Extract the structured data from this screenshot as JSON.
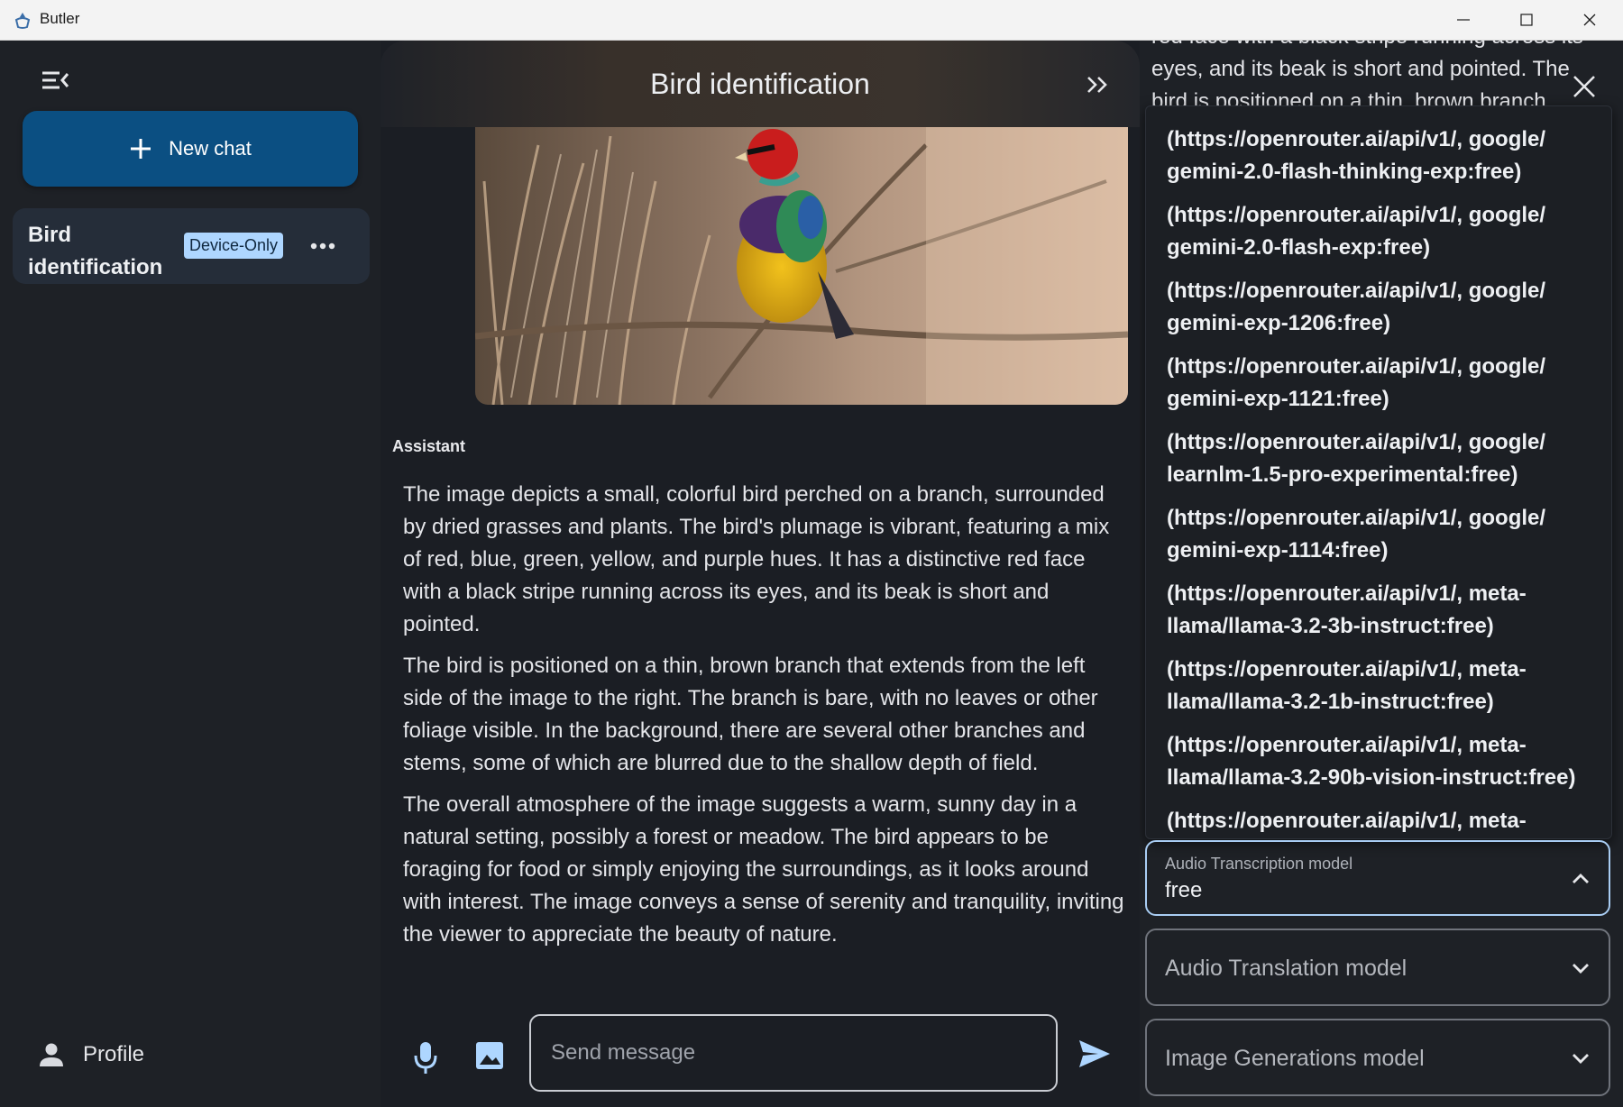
{
  "window": {
    "title": "Butler"
  },
  "sidebar": {
    "new_chat_label": "New chat",
    "chats": [
      {
        "title": "Bird identification",
        "badge": "Device-Only"
      }
    ],
    "profile_label": "Profile"
  },
  "chat": {
    "title": "Bird identification",
    "role": "Assistant",
    "paragraphs": [
      "The image depicts a small, colorful bird perched on a branch, surrounded by dried grasses and plants. The bird's plumage is vibrant, featuring a mix of red, blue, green, yellow, and purple hues. It has a distinctive red face with a black stripe running across its eyes, and its beak is short and pointed.",
      "The bird is positioned on a thin, brown branch that extends from the left side of the image to the right. The branch is bare, with no leaves or other foliage visible. In the background, there are several other branches and stems, some of which are blurred due to the shallow depth of field.",
      "The overall atmosphere of the image suggests a warm, sunny day in a natural setting, possibly a forest or meadow. The bird appears to be foraging for food or simply enjoying the surroundings, as it looks around with interest. The image conveys a sense of serenity and tranquility, inviting the viewer to appreciate the beauty of nature."
    ],
    "composer_placeholder": "Send message"
  },
  "settings": {
    "overflow_text": "red face with a black stripe running across its eyes, and its beak is short and pointed. The bird is positioned on a thin, brown branch",
    "model_options": [
      "(https://openrouter.ai/api/v1/, google/\ngemini-2.0-flash-thinking-exp:free)",
      "(https://openrouter.ai/api/v1/, google/\ngemini-2.0-flash-exp:free)",
      "(https://openrouter.ai/api/v1/, google/\ngemini-exp-1206:free)",
      "(https://openrouter.ai/api/v1/, google/\ngemini-exp-1121:free)",
      "(https://openrouter.ai/api/v1/, google/\nlearnlm-1.5-pro-experimental:free)",
      "(https://openrouter.ai/api/v1/, google/\ngemini-exp-1114:free)",
      "(https://openrouter.ai/api/v1/, meta-\nllama/llama-3.2-3b-instruct:free)",
      "(https://openrouter.ai/api/v1/, meta-\nllama/llama-3.2-1b-instruct:free)",
      "(https://openrouter.ai/api/v1/, meta-\nllama/llama-3.2-90b-vision-instruct:free)",
      "(https://openrouter.ai/api/v1/, meta-"
    ],
    "audio_transcription": {
      "label": "Audio Transcription model",
      "value": "free"
    },
    "audio_translation": {
      "label": "Audio Translation model"
    },
    "image_generation": {
      "label": "Image Generations model"
    }
  },
  "colors": {
    "accent": "#0b4f82",
    "badge_bg": "#aed6ff",
    "focus_border": "#a9cdf3",
    "background": "#1b1e24"
  },
  "icons": [
    "app-icon",
    "menu-collapse-icon",
    "plus-icon",
    "more-horizontal-icon",
    "person-icon",
    "double-chevron-right-icon",
    "microphone-icon",
    "image-icon",
    "send-icon",
    "close-icon",
    "chevron-up-icon",
    "chevron-down-icon"
  ]
}
